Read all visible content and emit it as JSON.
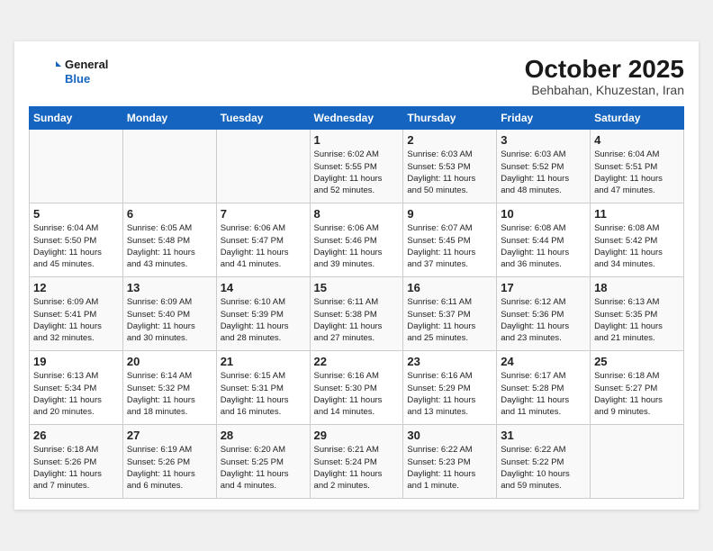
{
  "header": {
    "logo_line1": "General",
    "logo_line2": "Blue",
    "month": "October 2025",
    "location": "Behbahan, Khuzestan, Iran"
  },
  "weekdays": [
    "Sunday",
    "Monday",
    "Tuesday",
    "Wednesday",
    "Thursday",
    "Friday",
    "Saturday"
  ],
  "weeks": [
    [
      {
        "day": "",
        "info": ""
      },
      {
        "day": "",
        "info": ""
      },
      {
        "day": "",
        "info": ""
      },
      {
        "day": "1",
        "info": "Sunrise: 6:02 AM\nSunset: 5:55 PM\nDaylight: 11 hours\nand 52 minutes."
      },
      {
        "day": "2",
        "info": "Sunrise: 6:03 AM\nSunset: 5:53 PM\nDaylight: 11 hours\nand 50 minutes."
      },
      {
        "day": "3",
        "info": "Sunrise: 6:03 AM\nSunset: 5:52 PM\nDaylight: 11 hours\nand 48 minutes."
      },
      {
        "day": "4",
        "info": "Sunrise: 6:04 AM\nSunset: 5:51 PM\nDaylight: 11 hours\nand 47 minutes."
      }
    ],
    [
      {
        "day": "5",
        "info": "Sunrise: 6:04 AM\nSunset: 5:50 PM\nDaylight: 11 hours\nand 45 minutes."
      },
      {
        "day": "6",
        "info": "Sunrise: 6:05 AM\nSunset: 5:48 PM\nDaylight: 11 hours\nand 43 minutes."
      },
      {
        "day": "7",
        "info": "Sunrise: 6:06 AM\nSunset: 5:47 PM\nDaylight: 11 hours\nand 41 minutes."
      },
      {
        "day": "8",
        "info": "Sunrise: 6:06 AM\nSunset: 5:46 PM\nDaylight: 11 hours\nand 39 minutes."
      },
      {
        "day": "9",
        "info": "Sunrise: 6:07 AM\nSunset: 5:45 PM\nDaylight: 11 hours\nand 37 minutes."
      },
      {
        "day": "10",
        "info": "Sunrise: 6:08 AM\nSunset: 5:44 PM\nDaylight: 11 hours\nand 36 minutes."
      },
      {
        "day": "11",
        "info": "Sunrise: 6:08 AM\nSunset: 5:42 PM\nDaylight: 11 hours\nand 34 minutes."
      }
    ],
    [
      {
        "day": "12",
        "info": "Sunrise: 6:09 AM\nSunset: 5:41 PM\nDaylight: 11 hours\nand 32 minutes."
      },
      {
        "day": "13",
        "info": "Sunrise: 6:09 AM\nSunset: 5:40 PM\nDaylight: 11 hours\nand 30 minutes."
      },
      {
        "day": "14",
        "info": "Sunrise: 6:10 AM\nSunset: 5:39 PM\nDaylight: 11 hours\nand 28 minutes."
      },
      {
        "day": "15",
        "info": "Sunrise: 6:11 AM\nSunset: 5:38 PM\nDaylight: 11 hours\nand 27 minutes."
      },
      {
        "day": "16",
        "info": "Sunrise: 6:11 AM\nSunset: 5:37 PM\nDaylight: 11 hours\nand 25 minutes."
      },
      {
        "day": "17",
        "info": "Sunrise: 6:12 AM\nSunset: 5:36 PM\nDaylight: 11 hours\nand 23 minutes."
      },
      {
        "day": "18",
        "info": "Sunrise: 6:13 AM\nSunset: 5:35 PM\nDaylight: 11 hours\nand 21 minutes."
      }
    ],
    [
      {
        "day": "19",
        "info": "Sunrise: 6:13 AM\nSunset: 5:34 PM\nDaylight: 11 hours\nand 20 minutes."
      },
      {
        "day": "20",
        "info": "Sunrise: 6:14 AM\nSunset: 5:32 PM\nDaylight: 11 hours\nand 18 minutes."
      },
      {
        "day": "21",
        "info": "Sunrise: 6:15 AM\nSunset: 5:31 PM\nDaylight: 11 hours\nand 16 minutes."
      },
      {
        "day": "22",
        "info": "Sunrise: 6:16 AM\nSunset: 5:30 PM\nDaylight: 11 hours\nand 14 minutes."
      },
      {
        "day": "23",
        "info": "Sunrise: 6:16 AM\nSunset: 5:29 PM\nDaylight: 11 hours\nand 13 minutes."
      },
      {
        "day": "24",
        "info": "Sunrise: 6:17 AM\nSunset: 5:28 PM\nDaylight: 11 hours\nand 11 minutes."
      },
      {
        "day": "25",
        "info": "Sunrise: 6:18 AM\nSunset: 5:27 PM\nDaylight: 11 hours\nand 9 minutes."
      }
    ],
    [
      {
        "day": "26",
        "info": "Sunrise: 6:18 AM\nSunset: 5:26 PM\nDaylight: 11 hours\nand 7 minutes."
      },
      {
        "day": "27",
        "info": "Sunrise: 6:19 AM\nSunset: 5:26 PM\nDaylight: 11 hours\nand 6 minutes."
      },
      {
        "day": "28",
        "info": "Sunrise: 6:20 AM\nSunset: 5:25 PM\nDaylight: 11 hours\nand 4 minutes."
      },
      {
        "day": "29",
        "info": "Sunrise: 6:21 AM\nSunset: 5:24 PM\nDaylight: 11 hours\nand 2 minutes."
      },
      {
        "day": "30",
        "info": "Sunrise: 6:22 AM\nSunset: 5:23 PM\nDaylight: 11 hours\nand 1 minute."
      },
      {
        "day": "31",
        "info": "Sunrise: 6:22 AM\nSunset: 5:22 PM\nDaylight: 10 hours\nand 59 minutes."
      },
      {
        "day": "",
        "info": ""
      }
    ]
  ]
}
